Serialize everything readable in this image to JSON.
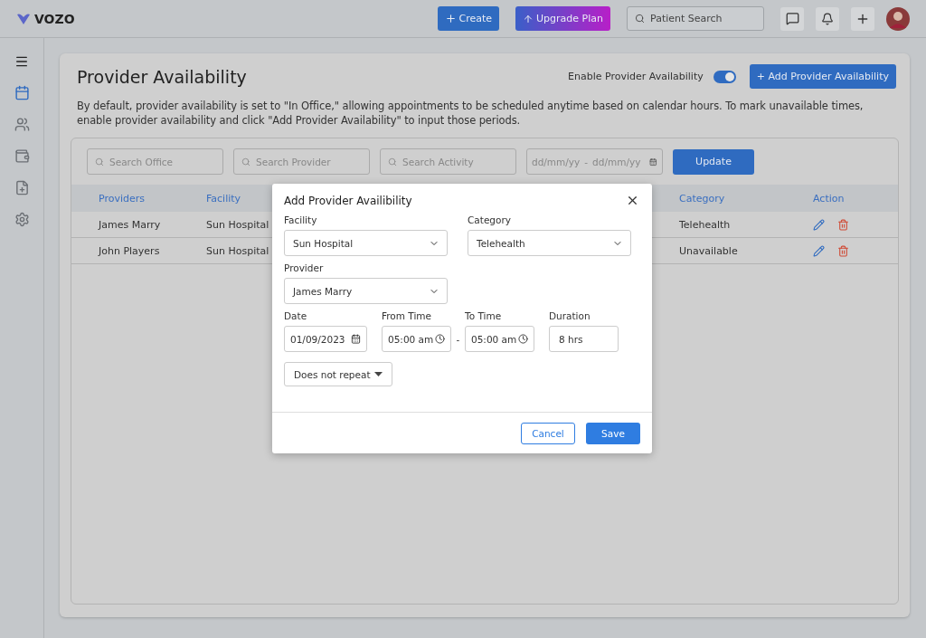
{
  "topbar": {
    "logo": "VOZO",
    "create": "Create",
    "upgrade": "Upgrade Plan",
    "search_placeholder": "Patient Search"
  },
  "sidebar": {
    "items": [
      {
        "kind": "calendar",
        "selected": true
      },
      {
        "kind": "people",
        "selected": false
      },
      {
        "kind": "wallet",
        "selected": false
      },
      {
        "kind": "file-plus",
        "selected": false
      },
      {
        "kind": "settings",
        "selected": false
      }
    ]
  },
  "page": {
    "title": "Provider Availability",
    "toggle_label": "Enable Provider Availability",
    "toggle_on": true,
    "add_button": "+ Add Provider Availability",
    "description": "By default, provider availability is set to \"In Office,\" allowing appointments to be scheduled anytime based on calendar hours. To mark unavailable times, enable provider availability and click \"Add Provider Availability\" to input those periods."
  },
  "filters": {
    "office_placeholder": "Search Office",
    "provider_placeholder": "Search Provider",
    "activity_placeholder": "Search Activity",
    "date_from_placeholder": "dd/mm/yy",
    "date_separator": "-",
    "date_to_placeholder": "dd/mm/yy",
    "update": "Update"
  },
  "table": {
    "columns": [
      "Providers",
      "Facility",
      "Category",
      "Action"
    ],
    "rows": [
      {
        "provider": "James Marry",
        "facility": "Sun Hospital",
        "category": "Telehealth"
      },
      {
        "provider": "John Players",
        "facility": "Sun Hospital",
        "category": "Unavailable"
      }
    ]
  },
  "dialog": {
    "title": "Add Provider Availibility",
    "facility": {
      "label": "Facility",
      "value": "Sun Hospital"
    },
    "category": {
      "label": "Category",
      "value": "Telehealth"
    },
    "provider": {
      "label": "Provider",
      "value": "James Marry"
    },
    "date": {
      "label": "Date",
      "value": "01/09/2023"
    },
    "from_time": {
      "label": "From Time",
      "value": "05:00 am"
    },
    "time_separator": "-",
    "to_time": {
      "label": "To Time",
      "value": "05:00 am"
    },
    "duration": {
      "label": "Duration",
      "value": "8 hrs"
    },
    "repeat": "Does not repeat",
    "cancel": "Cancel",
    "save": "Save"
  }
}
